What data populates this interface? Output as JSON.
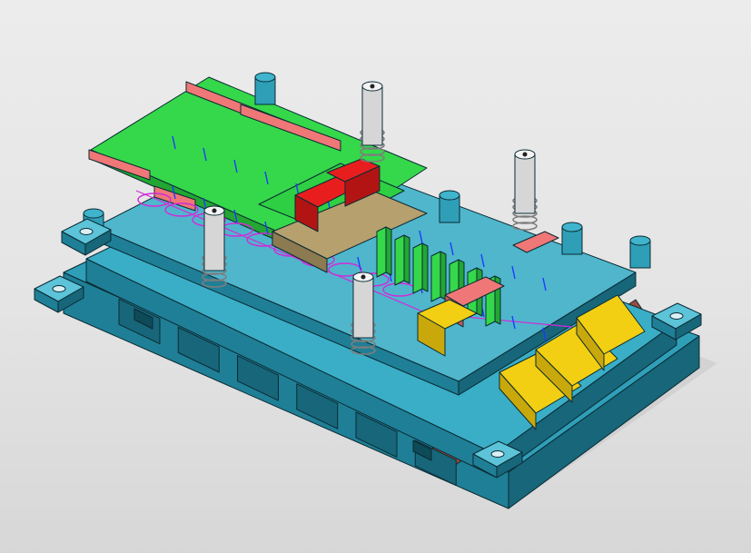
{
  "viewport": {
    "background_top": "#ececec",
    "background_bottom": "#d7d7d7"
  },
  "colors": {
    "base_plate": "#2f9fb8",
    "base_plate_top": "#3aaec6",
    "base_plate_side": "#1f7f96",
    "base_plate_dark": "#17667a",
    "die_shoe_rust": "#9a4a40",
    "strip_plate": "#35d84a",
    "strip_plate_dark": "#22a733",
    "clamp_pink": "#ef7777",
    "punch_red": "#e81e1e",
    "chute_yellow": "#f2cf12",
    "chute_yellow_dark": "#c9a80b",
    "guide_post": "#d6d6d6",
    "tan_block": "#b6a06e",
    "wireframe_magenta": "#d22ad8",
    "wireframe_blue": "#1b3cff",
    "outline": "#0b2a33"
  },
  "model": {
    "guide_post_count": 4,
    "corner_pad_count": 4,
    "ejection_chute_count": 3,
    "forming_station_count": 7
  }
}
